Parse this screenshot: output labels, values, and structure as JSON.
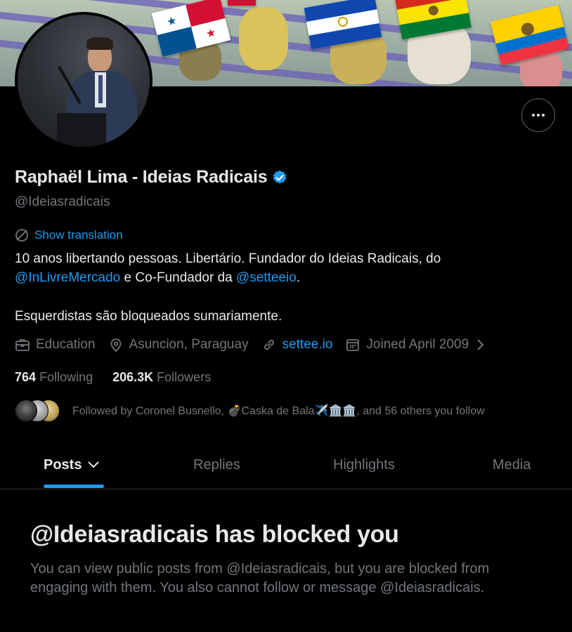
{
  "profile": {
    "name": "Raphaël Lima - Ideias Radicais",
    "handle": "@Ideiasradicais",
    "verified": true,
    "show_translation": "Show translation",
    "bio": {
      "line1": "10 anos libertando pessoas. Libertário. Fundador do Ideias Radicais, do",
      "mention1": "@InLivreMercado",
      "mid": " e Co-Fundador da ",
      "mention2": "@setteeio",
      "end": ".",
      "line3": "Esquerdistas são bloqueados sumariamente."
    },
    "meta": {
      "category": "Education",
      "location": "Asuncion, Paraguay",
      "website": "settee.io",
      "joined": "Joined April 2009"
    },
    "following_count": "764",
    "following_label": "Following",
    "followers_count": "206.3K",
    "followers_label": "Followers",
    "followed_by": "Followed by Coronel Busnello, 💣Caska de Bala✈️🏛️🏛️, and 56 others you follow"
  },
  "tabs": [
    {
      "label": "Posts",
      "active": true
    },
    {
      "label": "Replies",
      "active": false
    },
    {
      "label": "Highlights",
      "active": false
    },
    {
      "label": "Media",
      "active": false
    }
  ],
  "blocked": {
    "title": "@Ideiasradicais has blocked you",
    "text": "You can view public posts from @Ideiasradicais, but you are blocked from engaging with them. You also cannot follow or message @Ideiasradicais."
  },
  "colors": {
    "accent": "#1d9bf0",
    "muted": "#71767b",
    "text": "#e7e9ea",
    "background": "#000000"
  },
  "icons": [
    "more-icon",
    "verified-badge-icon",
    "translate-icon",
    "briefcase-icon",
    "location-pin-icon",
    "link-icon",
    "calendar-icon",
    "chevron-right-icon",
    "chevron-down-icon"
  ]
}
